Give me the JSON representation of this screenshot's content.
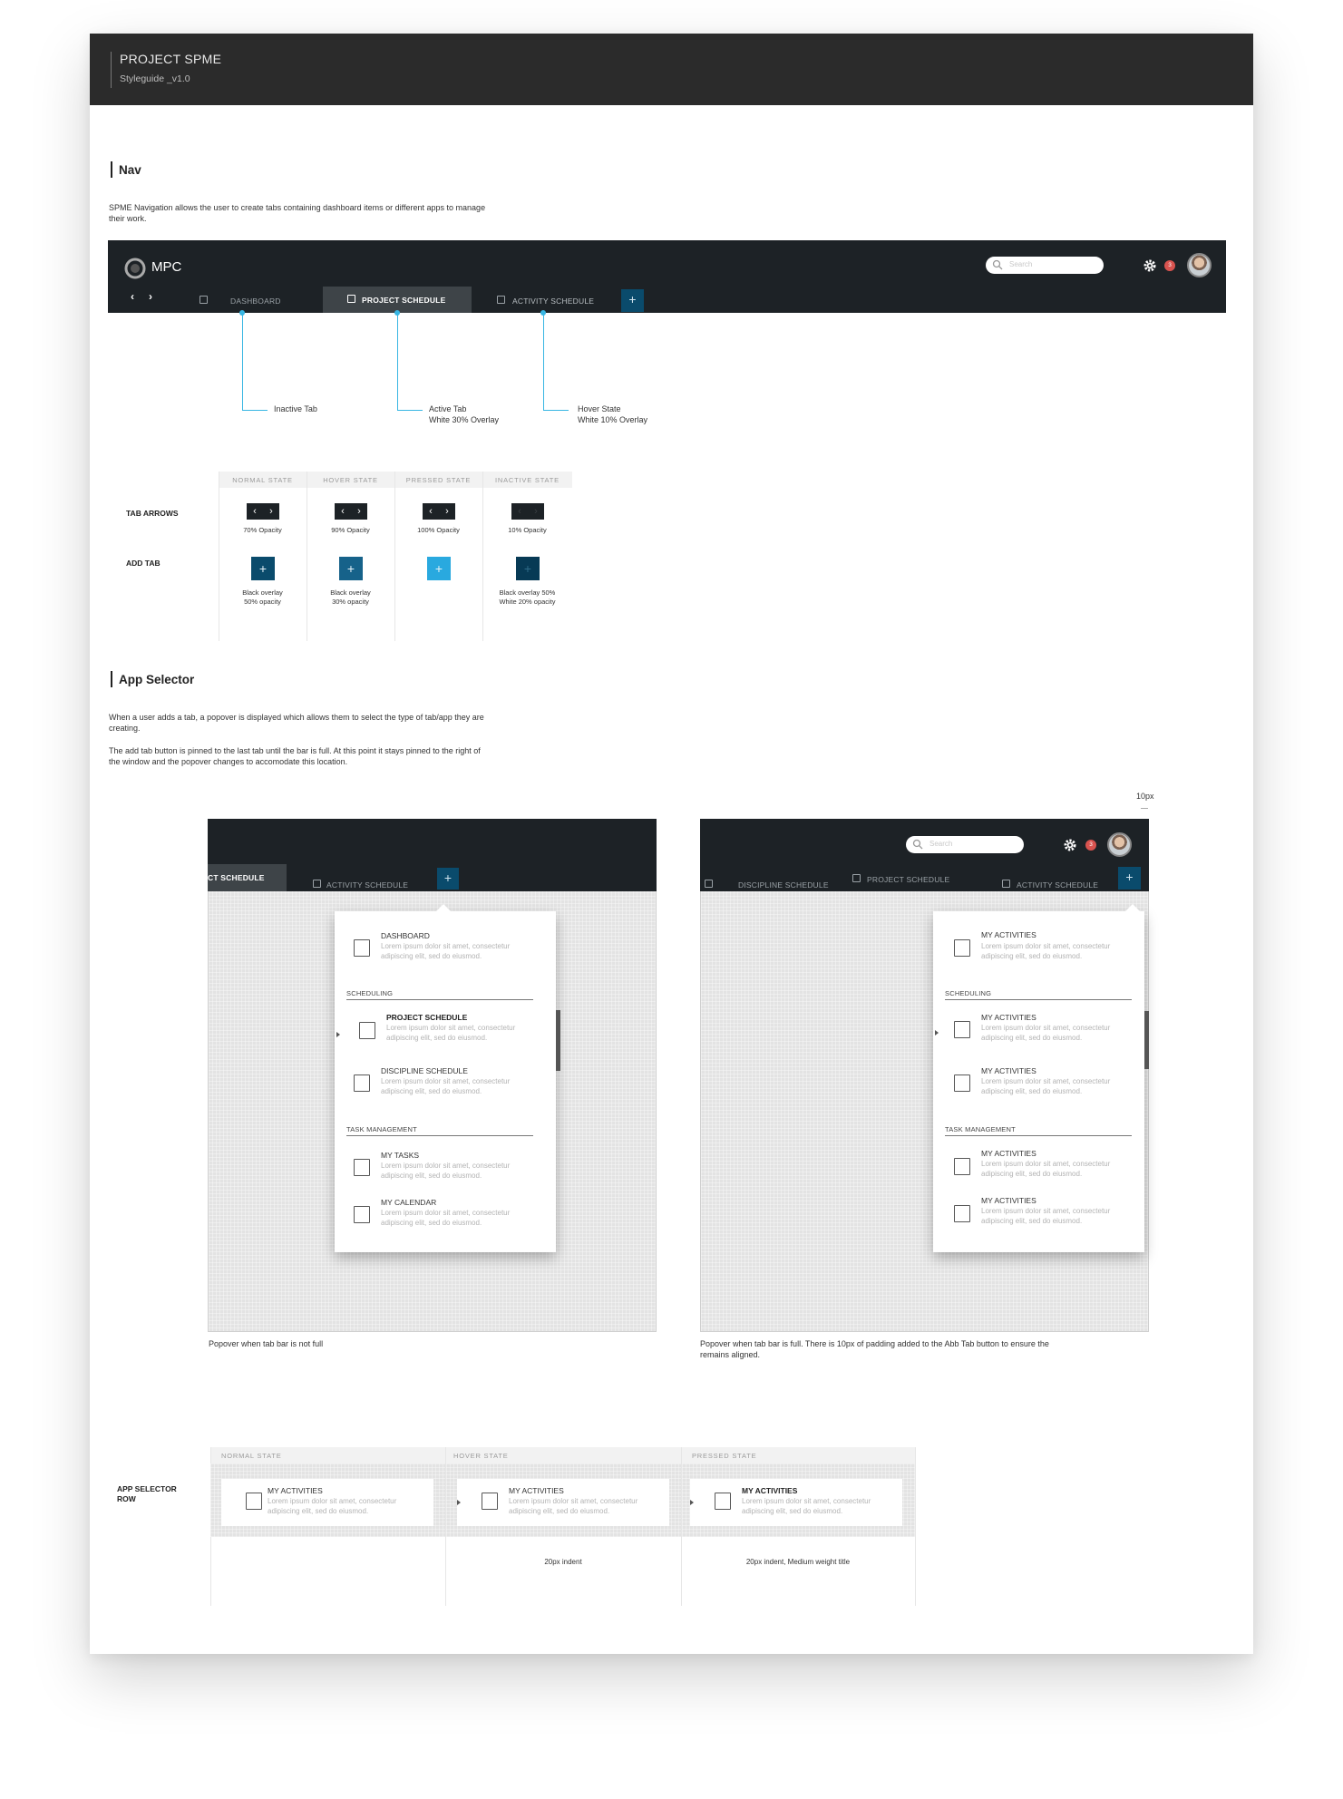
{
  "header": {
    "title": "PROJECT SPME",
    "subtitle": "Styleguide _v1.0"
  },
  "nav_section": {
    "title": "Nav",
    "description": "SPME Navigation allows the user to create tabs containing dashboard items or different apps to manage their work.",
    "app_name": "MPC",
    "search_placeholder": "Search",
    "notification_count": "3",
    "tabs": [
      {
        "label": "DASHBOARD",
        "state": "inactive"
      },
      {
        "label": "PROJECT SCHEDULE",
        "state": "active"
      },
      {
        "label": "ACTIVITY SCHEDULE",
        "state": "hover"
      }
    ],
    "add_tab_symbol": "+",
    "annotations": [
      {
        "line1": "Inactive Tab",
        "line2": ""
      },
      {
        "line1": "Active Tab",
        "line2": "White 30% Overlay"
      },
      {
        "line1": "Hover State",
        "line2": "White 10% Overlay"
      }
    ]
  },
  "states_table": {
    "headers": [
      "NORMAL STATE",
      "HOVER STATE",
      "PRESSED STATE",
      "INACTIVE STATE"
    ],
    "rows": [
      {
        "label": "TAB ARROWS",
        "captions": [
          "70% Opacity",
          "90% Opacity",
          "100% Opacity",
          "10% Opacity"
        ]
      },
      {
        "label": "ADD TAB",
        "captions": [
          [
            "Black overlay",
            "50% opacity"
          ],
          [
            "Black overlay",
            "30% opacity"
          ],
          [
            "",
            ""
          ],
          [
            "Black overlay 50%",
            "White 20% opacity"
          ]
        ]
      }
    ],
    "colors": {
      "add_normal": "#0a4b6c",
      "add_hover": "#16628a",
      "add_pressed": "#29a9df",
      "add_inactive": "#073a55"
    }
  },
  "app_selector_section": {
    "title": "App Selector",
    "description1": "When a user adds a tab, a popover is displayed which allows them to select the type of tab/app they are creating.",
    "description2": "The add tab button is pinned to the last tab until the bar is full.  At this point it stays pinned to the right of the window and the popover changes to accomodate this location.",
    "padding_label": "10px",
    "left_frame": {
      "tabs": [
        "CT SCHEDULE",
        "ACTIVITY SCHEDULE"
      ],
      "items_top": [
        {
          "title": "DASHBOARD",
          "desc": "Lorem ipsum dolor sit amet, consectetur adipiscing elit, sed do eiusmod."
        }
      ],
      "group1": "SCHEDULING",
      "items_g1": [
        {
          "title": "PROJECT SCHEDULE",
          "desc": "Lorem ipsum dolor sit amet, consectetur adipiscing elit, sed do eiusmod."
        },
        {
          "title": "DISCIPLINE SCHEDULE",
          "desc": "Lorem ipsum dolor sit amet, consectetur adipiscing elit, sed do eiusmod."
        }
      ],
      "group2": "TASK MANAGEMENT",
      "items_g2": [
        {
          "title": "MY TASKS",
          "desc": "Lorem ipsum dolor sit amet, consectetur adipiscing elit, sed do eiusmod."
        },
        {
          "title": "MY CALENDAR",
          "desc": "Lorem ipsum dolor sit amet, consectetur adipiscing elit, sed do eiusmod."
        }
      ],
      "caption": "Popover when tab bar is not full"
    },
    "right_frame": {
      "tabs": [
        "DISCIPLINE SCHEDULE",
        "PROJECT SCHEDULE",
        "ACTIVITY SCHEDULE"
      ],
      "search_placeholder": "Search",
      "notification_count": "3",
      "items_top": [
        {
          "title": "MY ACTIVITIES",
          "desc": "Lorem ipsum dolor sit amet, consectetur adipiscing elit, sed do eiusmod."
        }
      ],
      "group1": "SCHEDULING",
      "items_g1": [
        {
          "title": "MY ACTIVITIES",
          "desc": "Lorem ipsum dolor sit amet, consectetur adipiscing elit, sed do eiusmod."
        },
        {
          "title": "MY ACTIVITIES",
          "desc": "Lorem ipsum dolor sit amet, consectetur adipiscing elit, sed do eiusmod."
        }
      ],
      "group2": "TASK MANAGEMENT",
      "items_g2": [
        {
          "title": "MY ACTIVITIES",
          "desc": "Lorem ipsum dolor sit amet, consectetur adipiscing elit, sed do eiusmod."
        },
        {
          "title": "MY ACTIVITIES",
          "desc": "Lorem ipsum dolor sit amet, consectetur adipiscing elit, sed do eiusmod."
        }
      ],
      "caption": "Popover  when tab bar is full. There is 10px of padding added to the Abb Tab button to ensure the remains aligned."
    }
  },
  "row_states": {
    "label_line1": "APP SELECTOR",
    "label_line2": "ROW",
    "headers": [
      "NORMAL STATE",
      "HOVER STATE",
      "PRESSED STATE"
    ],
    "item_title": "MY ACTIVITIES",
    "item_desc": "Lorem ipsum dolor sit amet, consectetur adipiscing elit, sed do eiusmod.",
    "notes": [
      "",
      "20px indent",
      "20px indent, Medium weight title"
    ]
  }
}
